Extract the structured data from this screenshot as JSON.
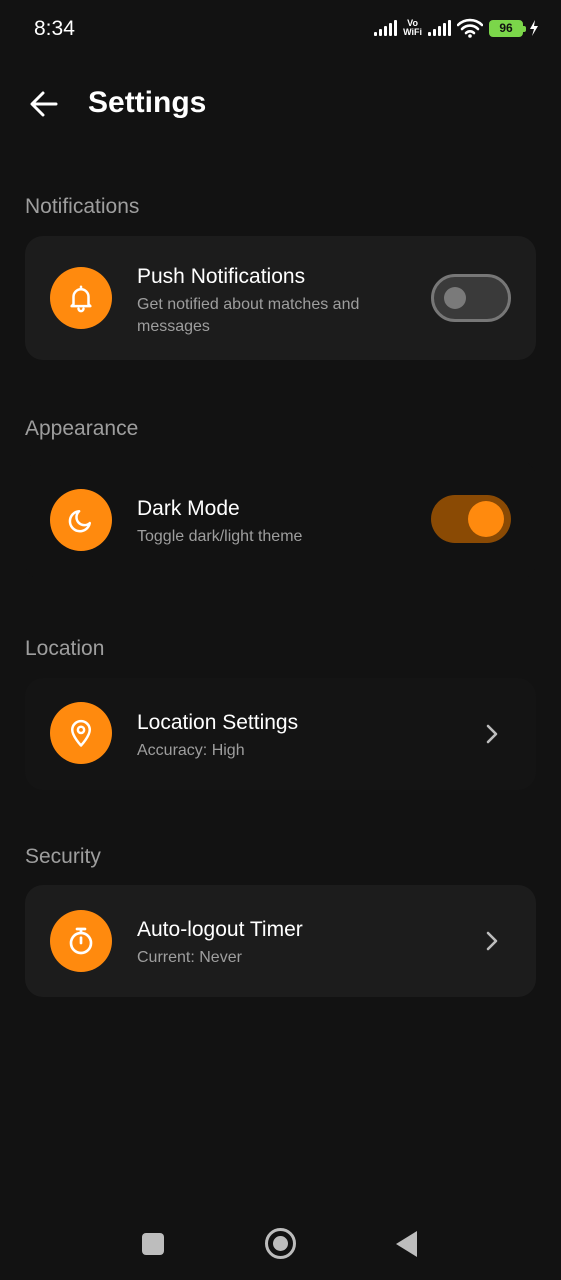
{
  "status_bar": {
    "time": "8:34",
    "volte_line1": "Vo",
    "volte_line2": "WiFi",
    "battery": "96"
  },
  "header": {
    "title": "Settings",
    "back_icon": "arrow-left-icon"
  },
  "sections": {
    "notifications": {
      "title": "Notifications",
      "item_title": "Push Notifications",
      "item_subtitle": "Get notified about matches and messages",
      "icon": "bell-icon",
      "toggle_on": false
    },
    "appearance": {
      "title": "Appearance",
      "item_title": "Dark Mode",
      "item_subtitle": "Toggle dark/light theme",
      "icon": "moon-icon",
      "toggle_on": true
    },
    "location": {
      "title": "Location",
      "item_title": "Location Settings",
      "item_subtitle": "Accuracy: High",
      "icon": "map-pin-icon"
    },
    "security": {
      "title": "Security",
      "item_title": "Auto-logout Timer",
      "item_subtitle": "Current: Never",
      "icon": "stopwatch-icon"
    }
  },
  "colors": {
    "background": "#121212",
    "card": "#1c1c1c",
    "accent": "#ff8a0e",
    "toggle_on_track": "#8a4a04",
    "muted_text": "#9e9e9e"
  }
}
